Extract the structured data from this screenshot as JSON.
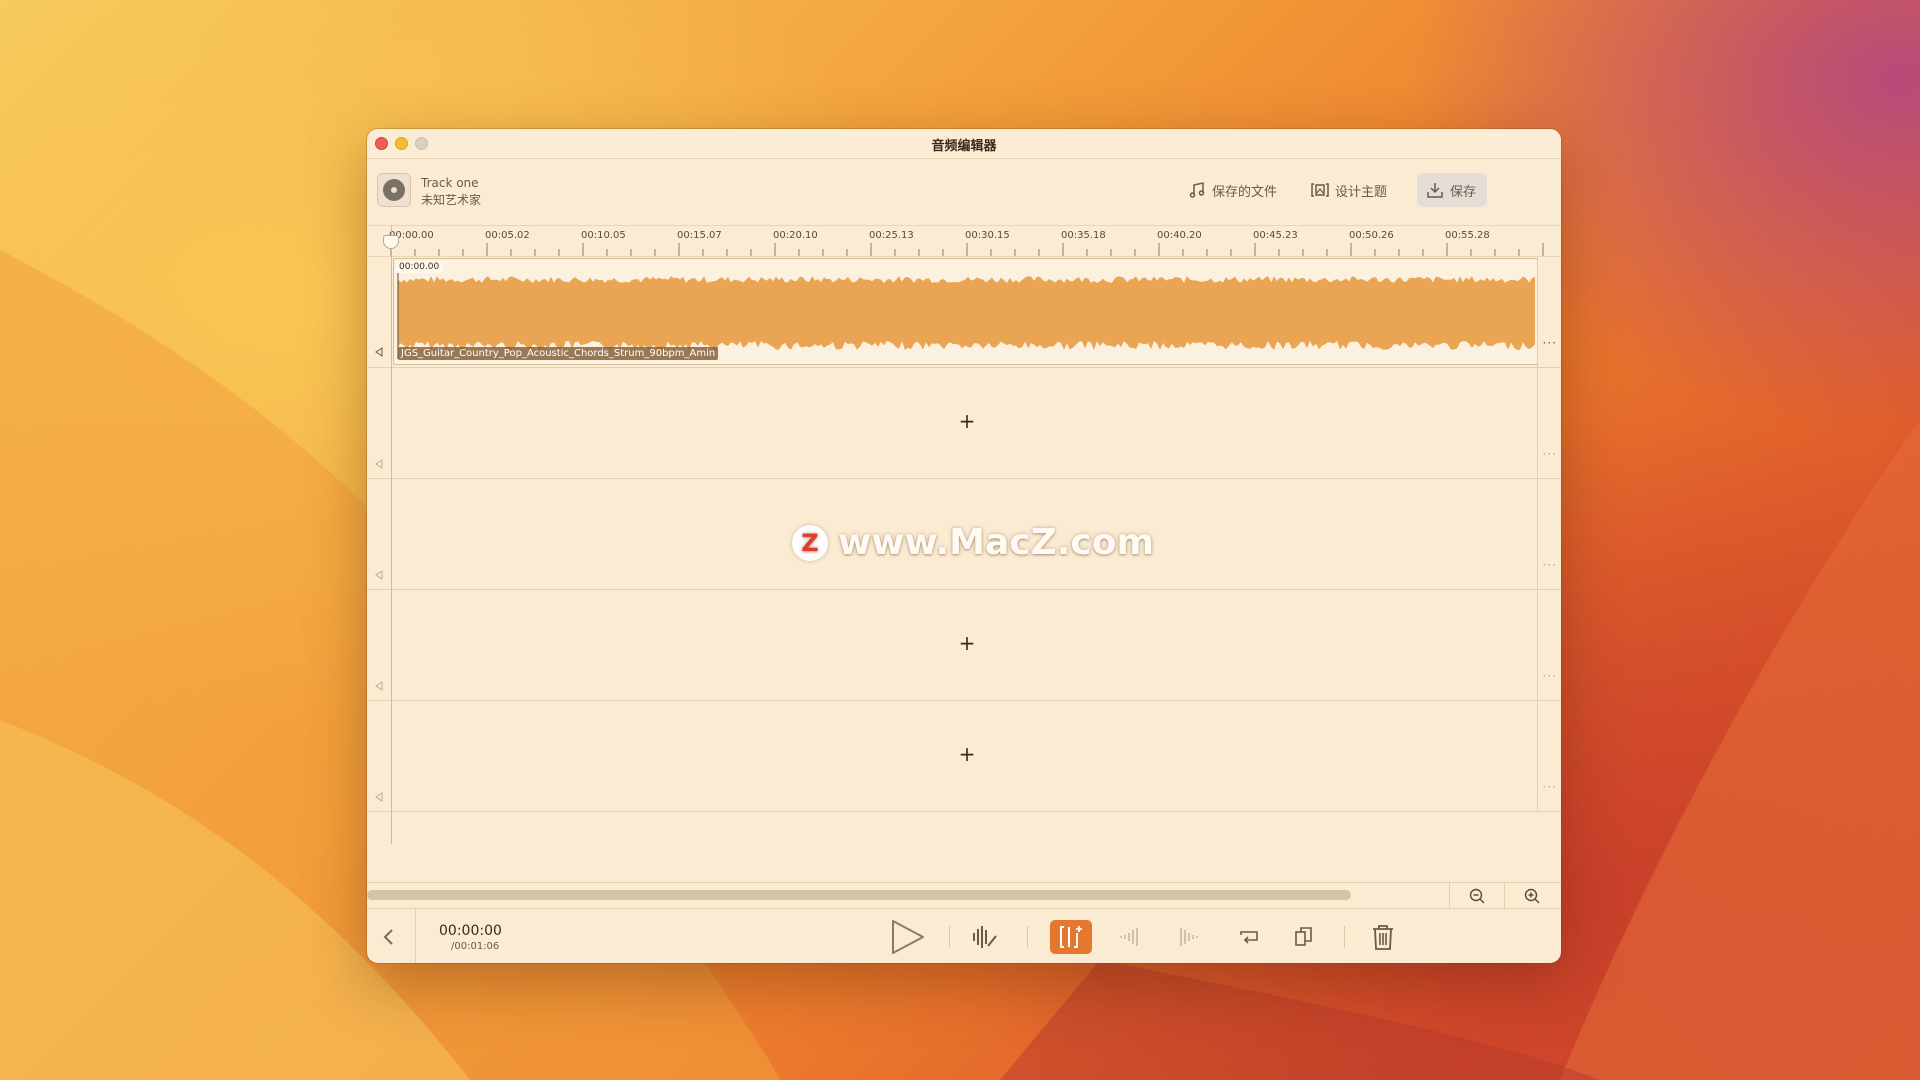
{
  "window": {
    "title": "音频编辑器"
  },
  "header": {
    "track_name": "Track one",
    "artist": "未知艺术家",
    "saved_files_label": "保存的文件",
    "design_theme_label": "设计主题",
    "save_label": "保存"
  },
  "ruler": {
    "labels": [
      "00:00.00",
      "00:05.02",
      "00:10.05",
      "00:15.07",
      "00:20.10",
      "00:25.13",
      "00:30.15",
      "00:35.18",
      "00:40.20",
      "00:45.23",
      "00:50.26",
      "00:55.28"
    ]
  },
  "clip": {
    "start_time": "00:00.00",
    "file_name": "JGS_Guitar_Country_Pop_Acoustic_Chords_Strum_90bpm_Amin"
  },
  "lanes": {
    "add_symbol": "+",
    "more_symbol": "···"
  },
  "watermark": {
    "logo_letter": "Z",
    "text": "www.MacZ.com"
  },
  "transport": {
    "current_time": "00:00:00",
    "total_time": "/00:01:06"
  },
  "colors": {
    "waveform": "#e9a553",
    "accent": "#e5772f",
    "window_bg": "#fbebd3"
  },
  "icons": {
    "album": "disc-icon",
    "saved_files": "music-note-icon",
    "design_theme": "theme-frame-icon",
    "save": "download-icon",
    "back": "chevron-left-icon",
    "play": "play-icon",
    "wave_edit": "waveform-edit-icon",
    "split": "split-clip-icon",
    "fade_in": "fade-in-icon",
    "fade_out": "fade-out-icon",
    "loop": "loop-icon",
    "copy": "copy-icon",
    "delete": "trash-icon",
    "zoom_out": "zoom-out-icon",
    "zoom_in": "zoom-in-icon"
  }
}
